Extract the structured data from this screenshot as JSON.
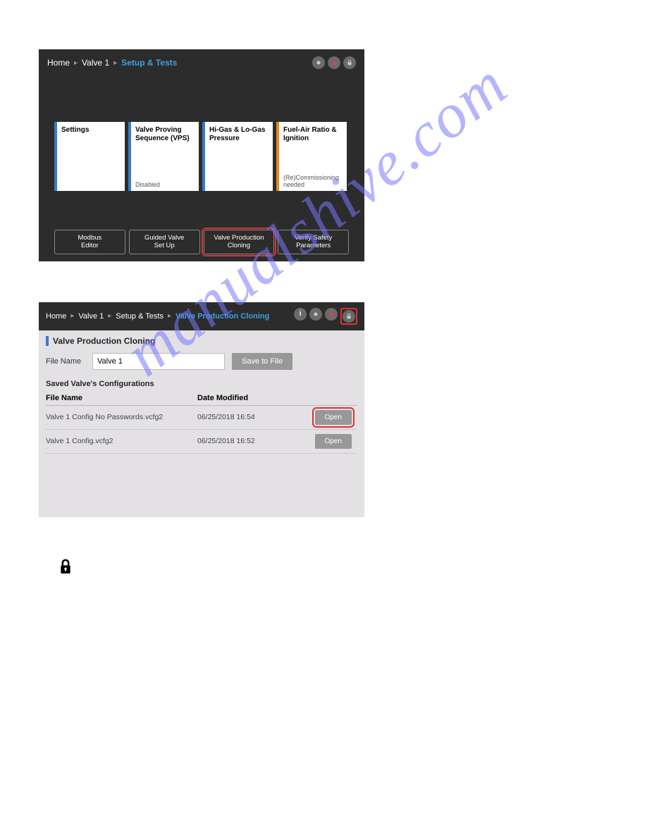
{
  "watermark": "manualshive.com",
  "panel1": {
    "breadcrumb": {
      "home": "Home",
      "valve": "Valve 1",
      "current": "Setup & Tests"
    },
    "cards": [
      {
        "title": "Settings",
        "status": "",
        "accent": "blue"
      },
      {
        "title": "Valve Proving Sequence (VPS)",
        "status": "Disabled",
        "accent": "blue"
      },
      {
        "title": "Hi-Gas & Lo-Gas Pressure",
        "status": "",
        "accent": "blue"
      },
      {
        "title": "Fuel-Air Ratio & Ignition",
        "status": "(Re)Commissioning needed",
        "accent": "orange"
      }
    ],
    "buttons": [
      {
        "line1": "Modbus",
        "line2": "Editor"
      },
      {
        "line1": "Guided Valve",
        "line2": "Set Up"
      },
      {
        "line1": "Valve Production",
        "line2": "Cloning"
      },
      {
        "line1": "Verify Safety",
        "line2": "Parameters"
      }
    ]
  },
  "panel2": {
    "breadcrumb": {
      "home": "Home",
      "valve": "Valve 1",
      "setup": "Setup & Tests",
      "current": "Valve Production Cloning"
    },
    "section_title": "Valve Production Cloning",
    "file_name_label": "File Name",
    "file_name_value": "Valve 1",
    "save_label": "Save to File",
    "saved_heading": "Saved Valve's Configurations",
    "col_fname": "File Name",
    "col_date": "Date Modified",
    "rows": [
      {
        "fname": "Valve 1 Config No Passwords.vcfg2",
        "date": "06/25/2018 16:54",
        "action": "Open"
      },
      {
        "fname": "Valve 1 Config.vcfg2",
        "date": "06/25/2018 16:52",
        "action": "Open"
      }
    ]
  }
}
